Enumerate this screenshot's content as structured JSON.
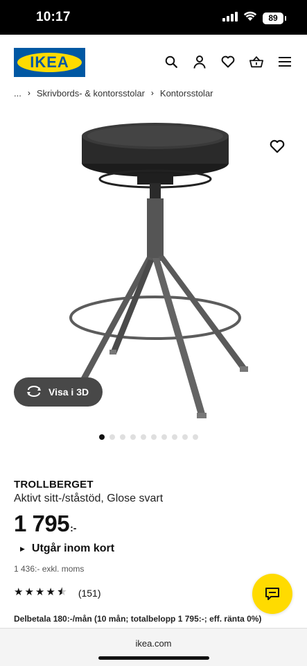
{
  "status_bar": {
    "time": "10:17",
    "battery": "89",
    "icons": [
      "signal-icon",
      "wifi-icon",
      "battery-icon"
    ]
  },
  "header": {
    "logo_text": "IKEA",
    "brand_colors": {
      "blue": "#0058a3",
      "yellow": "#ffdb00"
    },
    "icons": [
      "search-icon",
      "account-icon",
      "favorites-icon",
      "cart-icon",
      "menu-icon"
    ]
  },
  "breadcrumb": {
    "ellipsis": "...",
    "items": [
      "Skrivbords- & kontorsstolar",
      "Kontorsstolar"
    ]
  },
  "product": {
    "name": "TROLLBERGET",
    "description": "Aktivt sitt-/ståstöd, Glose svart",
    "price": "1 795",
    "price_suffix": ":-",
    "availability": "Utgår inom kort",
    "excl_vat": "1 436:- exkl. moms",
    "rating_value": 4.5,
    "rating_max": 5,
    "rating_count": "(151)",
    "installment": "Delbetala 180:-/mån (10 mån; totalbelopp 1 795:-; eff. ränta 0%)"
  },
  "media": {
    "view_3d_label": "Visa i 3D",
    "dot_count": 10,
    "active_dot": 0
  },
  "footer": {
    "url": "ikea.com"
  }
}
